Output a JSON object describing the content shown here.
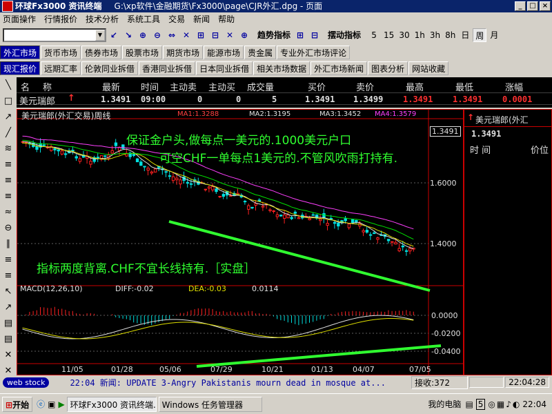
{
  "window": {
    "title": "环球Fx3000 资讯终端",
    "path": "G:\\xp软件\\金融期货\\Fx3000\\page\\CJR外汇.dpg - 页面",
    "btn_min": "_",
    "btn_max": "□",
    "btn_close": "×"
  },
  "menu": [
    "页面操作",
    "行情报价",
    "技术分析",
    "系统工具",
    "交易",
    "新闻",
    "帮助"
  ],
  "toolbar": {
    "combo_value": "",
    "icons_a": [
      "↙",
      "↘",
      "⊕",
      "⊖",
      "⇔",
      "✕",
      "⊞",
      "⊟",
      "✕",
      "⊕"
    ],
    "trend_label": "趋势指标",
    "icons_b": [
      "⊞",
      "⊟"
    ],
    "swing_label": "摆动指标",
    "periods": [
      "5",
      "15",
      "30",
      "1h",
      "3h",
      "8h",
      "日",
      "周",
      "月"
    ],
    "selected_period": "周"
  },
  "tabs1": [
    "外汇市场",
    "货币市场",
    "债券市场",
    "股票市场",
    "期货市场",
    "能源市场",
    "贵金属",
    "专业外汇市场评论"
  ],
  "tabs2": [
    "现汇报价",
    "远期汇率",
    "伦敦同业拆借",
    "香港同业拆借",
    "日本同业拆借",
    "相关市场数据",
    "外汇市场新闻",
    "图表分析",
    "网站收藏"
  ],
  "left_tools": [
    "╲",
    "□",
    "↗",
    "╱",
    "≋",
    "≡",
    "≡",
    "≡",
    "≈",
    "⊖",
    "∥",
    "≡",
    "≡",
    "↖",
    "↗",
    "▤",
    "▤",
    "✕",
    "✕"
  ],
  "quote": {
    "headers": [
      "名",
      "称",
      "最新",
      "时间",
      "主动卖",
      "主动买",
      "成交量",
      "买价",
      "卖价",
      "最高",
      "最低",
      "涨幅"
    ],
    "row": [
      "美元瑞郎",
      "1.3491",
      "09:00",
      "0",
      "0",
      "5",
      "1.3491",
      "1.3499",
      "1.3491",
      "1.3491",
      "0.0001"
    ],
    "arrow": "↑"
  },
  "chart": {
    "title": "美元瑞郎(外汇交易)周线",
    "ma": [
      "MA1:1.3288",
      "MA2:1.3195",
      "MA3:1.3452",
      "MA4:1.3579"
    ],
    "price_ticks": [
      "1.3491",
      "1.6000",
      "1.4000"
    ],
    "annot1": "保证金户头,做每点一美元的.1000美元户口",
    "annot2": "可空CHF一单每点1美元的.不管风吹雨打持有.",
    "annot3": "指标两度背离.CHF不宜长线持有.［实盘］",
    "macd": [
      "MACD(12,26,10)",
      "DIFF:-0.02",
      "DEA:-0.03",
      "0.0114"
    ],
    "macd_ticks": [
      "0.0000",
      "-0.0200",
      "-0.0400"
    ],
    "x_ticks": [
      "11/05",
      "01/28",
      "05/06",
      "07/29",
      "10/21",
      "01/13",
      "04/07",
      "07/05"
    ],
    "colors": {
      "candle_up": "#ff2020",
      "candle_down": "#00e0e0",
      "ma1": "#e0e0e0",
      "ma2": "#e0e000",
      "ma3": "#00e000",
      "ma4": "#ff40ff",
      "trend": "#30ff30"
    }
  },
  "rpanel": {
    "name": "美元瑞郎(外汇",
    "price": "1.3491",
    "col1": "时 间",
    "col2": "价位"
  },
  "status": {
    "logo": "web stock",
    "news": "22:04 新闻: UPDATE 3-Angry Pakistanis mourn dead in mosque at...",
    "recv_label": "接收:372",
    "time": "22:04:28"
  },
  "taskbar": {
    "start": "开始",
    "task1": "环球Fx3000 资讯终端...",
    "task2": "Windows 任务管理器",
    "computer": "我的电脑",
    "num": "5",
    "clock": "22:04"
  }
}
